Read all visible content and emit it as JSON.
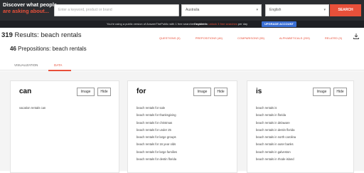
{
  "header": {
    "brand_line1": "Discover what people",
    "brand_are": "are",
    "brand_asking": "asking about...",
    "search_placeholder": "Enter a keyword, product or brand",
    "region": "Australia",
    "language": "English",
    "search_button": "SEARCH"
  },
  "notice": {
    "text": "You're using a public version of AnswerThePublic with 1 free searches available.",
    "register_prefix": "Register to",
    "register_link": "unlock 3 free searches",
    "register_suffix": "per day",
    "upgrade_button": "UPGRADE ACCOUNT"
  },
  "results": {
    "count": "319",
    "label": "Results: beach rentals",
    "prepositions_count": "46",
    "prepositions_label": "Prepositions: beach rentals"
  },
  "filters": [
    "QUESTIONS (0)",
    "PREPOSITIONS (46)",
    "COMPARISONS (55)",
    "ALPHABETICALS (209)",
    "RELATED (9)"
  ],
  "tabs": {
    "visualization": "VISUALIZATION",
    "data": "DATA"
  },
  "buttons": {
    "image": "Image",
    "hide": "Hide"
  },
  "cards": [
    {
      "title": "can",
      "items": [
        "vacation rentals can"
      ]
    },
    {
      "title": "for",
      "items": [
        "beach rentals for sale",
        "beach rentals for thanksgiving",
        "beach rentals for christmas",
        "beach rentals for under 25",
        "beach rentals for large groups",
        "beach rentals for 16 year olds",
        "beach rentals for large families",
        "beach rentals for destin florida"
      ]
    },
    {
      "title": "is",
      "items": [
        "beach rentals is",
        "beach rentals in florida",
        "beach rentals in delaware",
        "beach rentals in destin florida",
        "beach rentals in north carolina",
        "beach rentals in outer banks",
        "beach rentals in galveston",
        "beach rentals in rhode island"
      ]
    }
  ],
  "colors": {
    "accent": "#e8503a",
    "topbar": "#2b2d31",
    "upgrade": "#3b6fd4"
  }
}
